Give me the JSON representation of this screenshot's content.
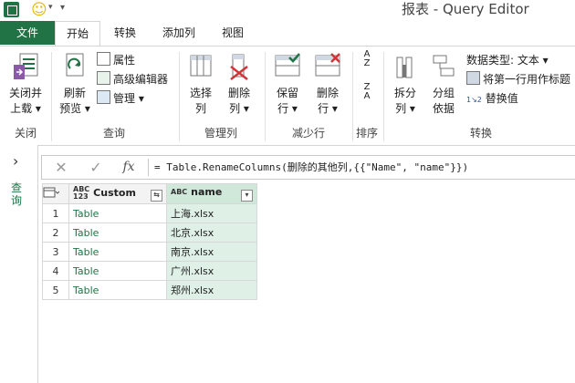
{
  "window": {
    "title": "报表 - Query Editor"
  },
  "quick_access": {
    "smiley": "☺",
    "dropdown": "▾",
    "more": "▾"
  },
  "tabs": [
    "文件",
    "开始",
    "转换",
    "添加列",
    "视图"
  ],
  "ribbon": {
    "close": {
      "label1": "关闭并",
      "label2": "上载 ▾",
      "group": "关闭"
    },
    "refresh": {
      "label1": "刷新",
      "label2": "预览 ▾"
    },
    "props": {
      "properties": "属性",
      "advanced_editor": "高级编辑器",
      "manage": "管理 ▾",
      "group": "查询"
    },
    "select_cols": {
      "label1": "选择",
      "label2": "列"
    },
    "remove_cols": {
      "label1": "删除",
      "label2": "列 ▾",
      "group": "管理列"
    },
    "keep_rows": {
      "label1": "保留",
      "label2": "行 ▾"
    },
    "remove_rows": {
      "label1": "删除",
      "label2": "行 ▾",
      "group": "减少行"
    },
    "sort": {
      "az": "A\nZ",
      "za": "Z\nA",
      "group": "排序"
    },
    "split": {
      "label1": "拆分",
      "label2": "列 ▾"
    },
    "groupby": {
      "label1": "分组",
      "label2": "依据"
    },
    "datatype": {
      "label": "数据类型: 文本 ▾"
    },
    "first_row_header": {
      "label": "将第一行用作标题"
    },
    "replace": {
      "label": "替换值",
      "prefix": "1↘2"
    },
    "transform_group": "转换"
  },
  "side_panel": {
    "chevron": "›",
    "label": "查询"
  },
  "formula_bar": {
    "cancel": "✕",
    "confirm": "✓",
    "fx": "fx",
    "formula": "= Table.RenameColumns(删除的其他列,{{\"Name\", \"name\"}})"
  },
  "table": {
    "columns": [
      {
        "type_label": "ABC\n123",
        "name": "Custom",
        "expand": "⇆"
      },
      {
        "type_label": "ABC",
        "name": "name",
        "filter": "▾"
      }
    ],
    "rows": [
      {
        "num": "1",
        "custom": "Table",
        "name": "上海.xlsx"
      },
      {
        "num": "2",
        "custom": "Table",
        "name": "北京.xlsx"
      },
      {
        "num": "3",
        "custom": "Table",
        "name": "南京.xlsx"
      },
      {
        "num": "4",
        "custom": "Table",
        "name": "广州.xlsx"
      },
      {
        "num": "5",
        "custom": "Table",
        "name": "郑州.xlsx"
      }
    ]
  },
  "colors": {
    "accent": "#217346",
    "selected_column": "#dff0e6"
  }
}
